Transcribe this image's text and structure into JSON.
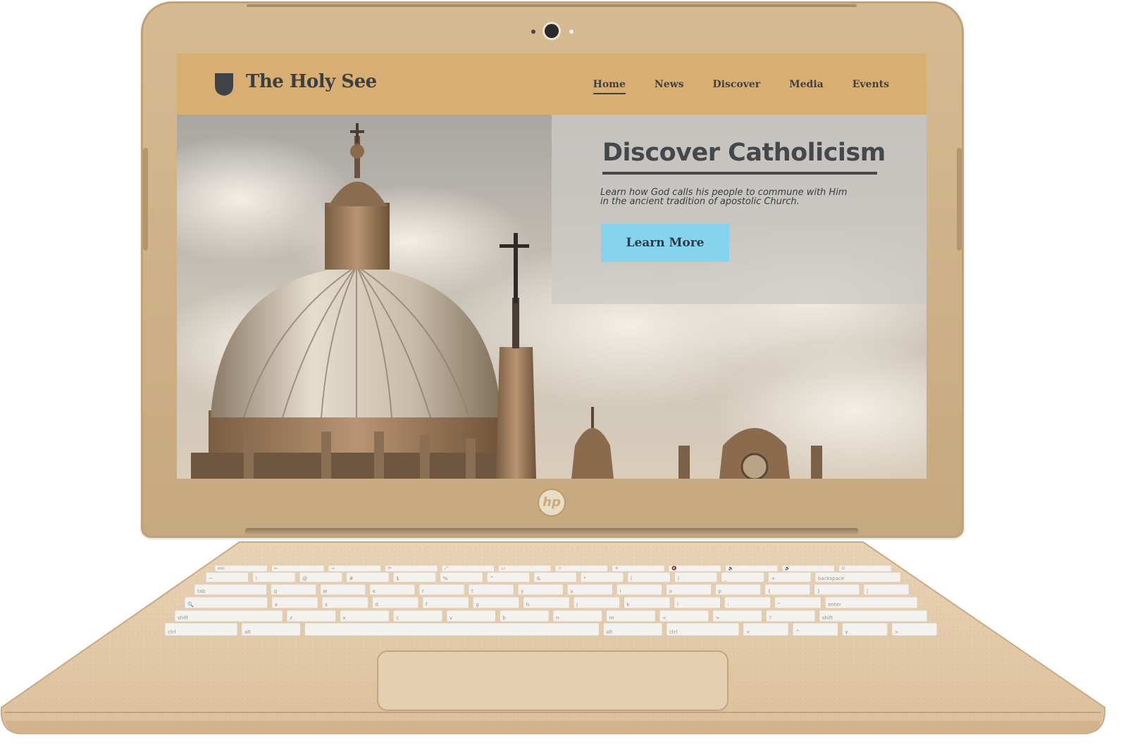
{
  "device": {
    "logo_text": "hp"
  },
  "site": {
    "brand_title": "The Holy See",
    "nav": [
      {
        "label": "Home",
        "active": true
      },
      {
        "label": "News",
        "active": false
      },
      {
        "label": "Discover",
        "active": false
      },
      {
        "label": "Media",
        "active": false
      },
      {
        "label": "Events",
        "active": false
      }
    ],
    "hero": {
      "headline": "Discover Catholicism",
      "lede": "Learn how God calls his people to commune with Him in the ancient tradition of apostolic Church.",
      "cta_label": "Learn More"
    }
  },
  "colors": {
    "nav_bg": "#d8ae72",
    "text_dark": "#45484b",
    "cta_bg": "#86d3ee",
    "laptop_gold": "#d6bb92"
  },
  "keyboard": {
    "rows": [
      [
        "esc",
        "←",
        "→",
        "⟳",
        "⤢",
        "▭",
        "☼",
        "☀",
        "🔇",
        "🔉",
        "🔊",
        "⏻"
      ],
      [
        "~",
        "!",
        "@",
        "#",
        "$",
        "%",
        "^",
        "&",
        "*",
        "(",
        ")",
        "_",
        "+",
        "backspace"
      ],
      [
        "tab",
        "q",
        "w",
        "e",
        "r",
        "t",
        "y",
        "u",
        "i",
        "o",
        "p",
        "{",
        "}",
        "|"
      ],
      [
        "🔍",
        "a",
        "s",
        "d",
        "f",
        "g",
        "h",
        "j",
        "k",
        "l",
        ":",
        "\"",
        "enter"
      ],
      [
        "shift",
        "z",
        "x",
        "c",
        "v",
        "b",
        "n",
        "m",
        "<",
        ">",
        "?",
        "shift"
      ],
      [
        "ctrl",
        "alt",
        "",
        "alt",
        "ctrl",
        "<",
        "^",
        "v",
        ">"
      ]
    ]
  }
}
